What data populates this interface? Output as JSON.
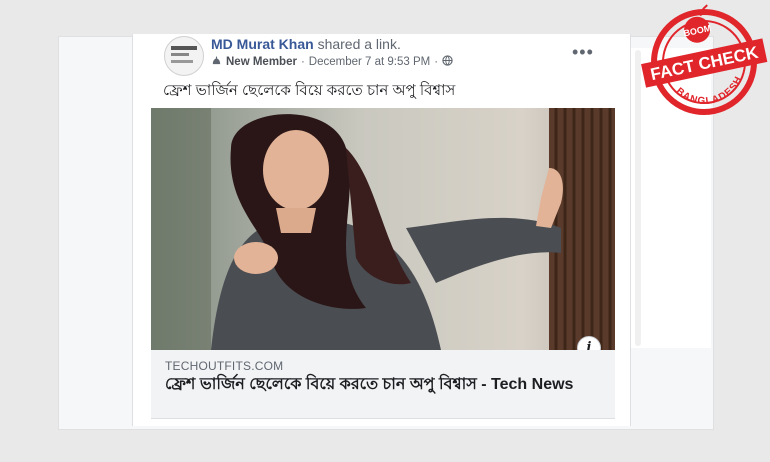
{
  "post": {
    "author": "MD Murat Khan",
    "action": "shared a link.",
    "badge": "New Member",
    "separator": "·",
    "date": "December 7 at 9:53 PM",
    "separator2": "·",
    "more": "•••",
    "text": "ফ্রেশ ভার্জিন ছেলেকে বিয়ে করতে চান অপু বিশ্বাস"
  },
  "link_preview": {
    "domain": "TECHOUTFITS.COM",
    "title": "ফ্রেশ ভার্জিন ছেলেকে বিয়ে করতে চান অপু বিশ্বাস - Tech News",
    "info": "i"
  },
  "stamp": {
    "top": "BOOM",
    "main": "FACT CHECK",
    "bottom": "BANGLADESH",
    "color": "#e0252b"
  },
  "icons": {
    "badge": "new-member-badge-icon",
    "privacy": "globe-icon",
    "more": "more-options-icon",
    "info": "info-icon"
  }
}
